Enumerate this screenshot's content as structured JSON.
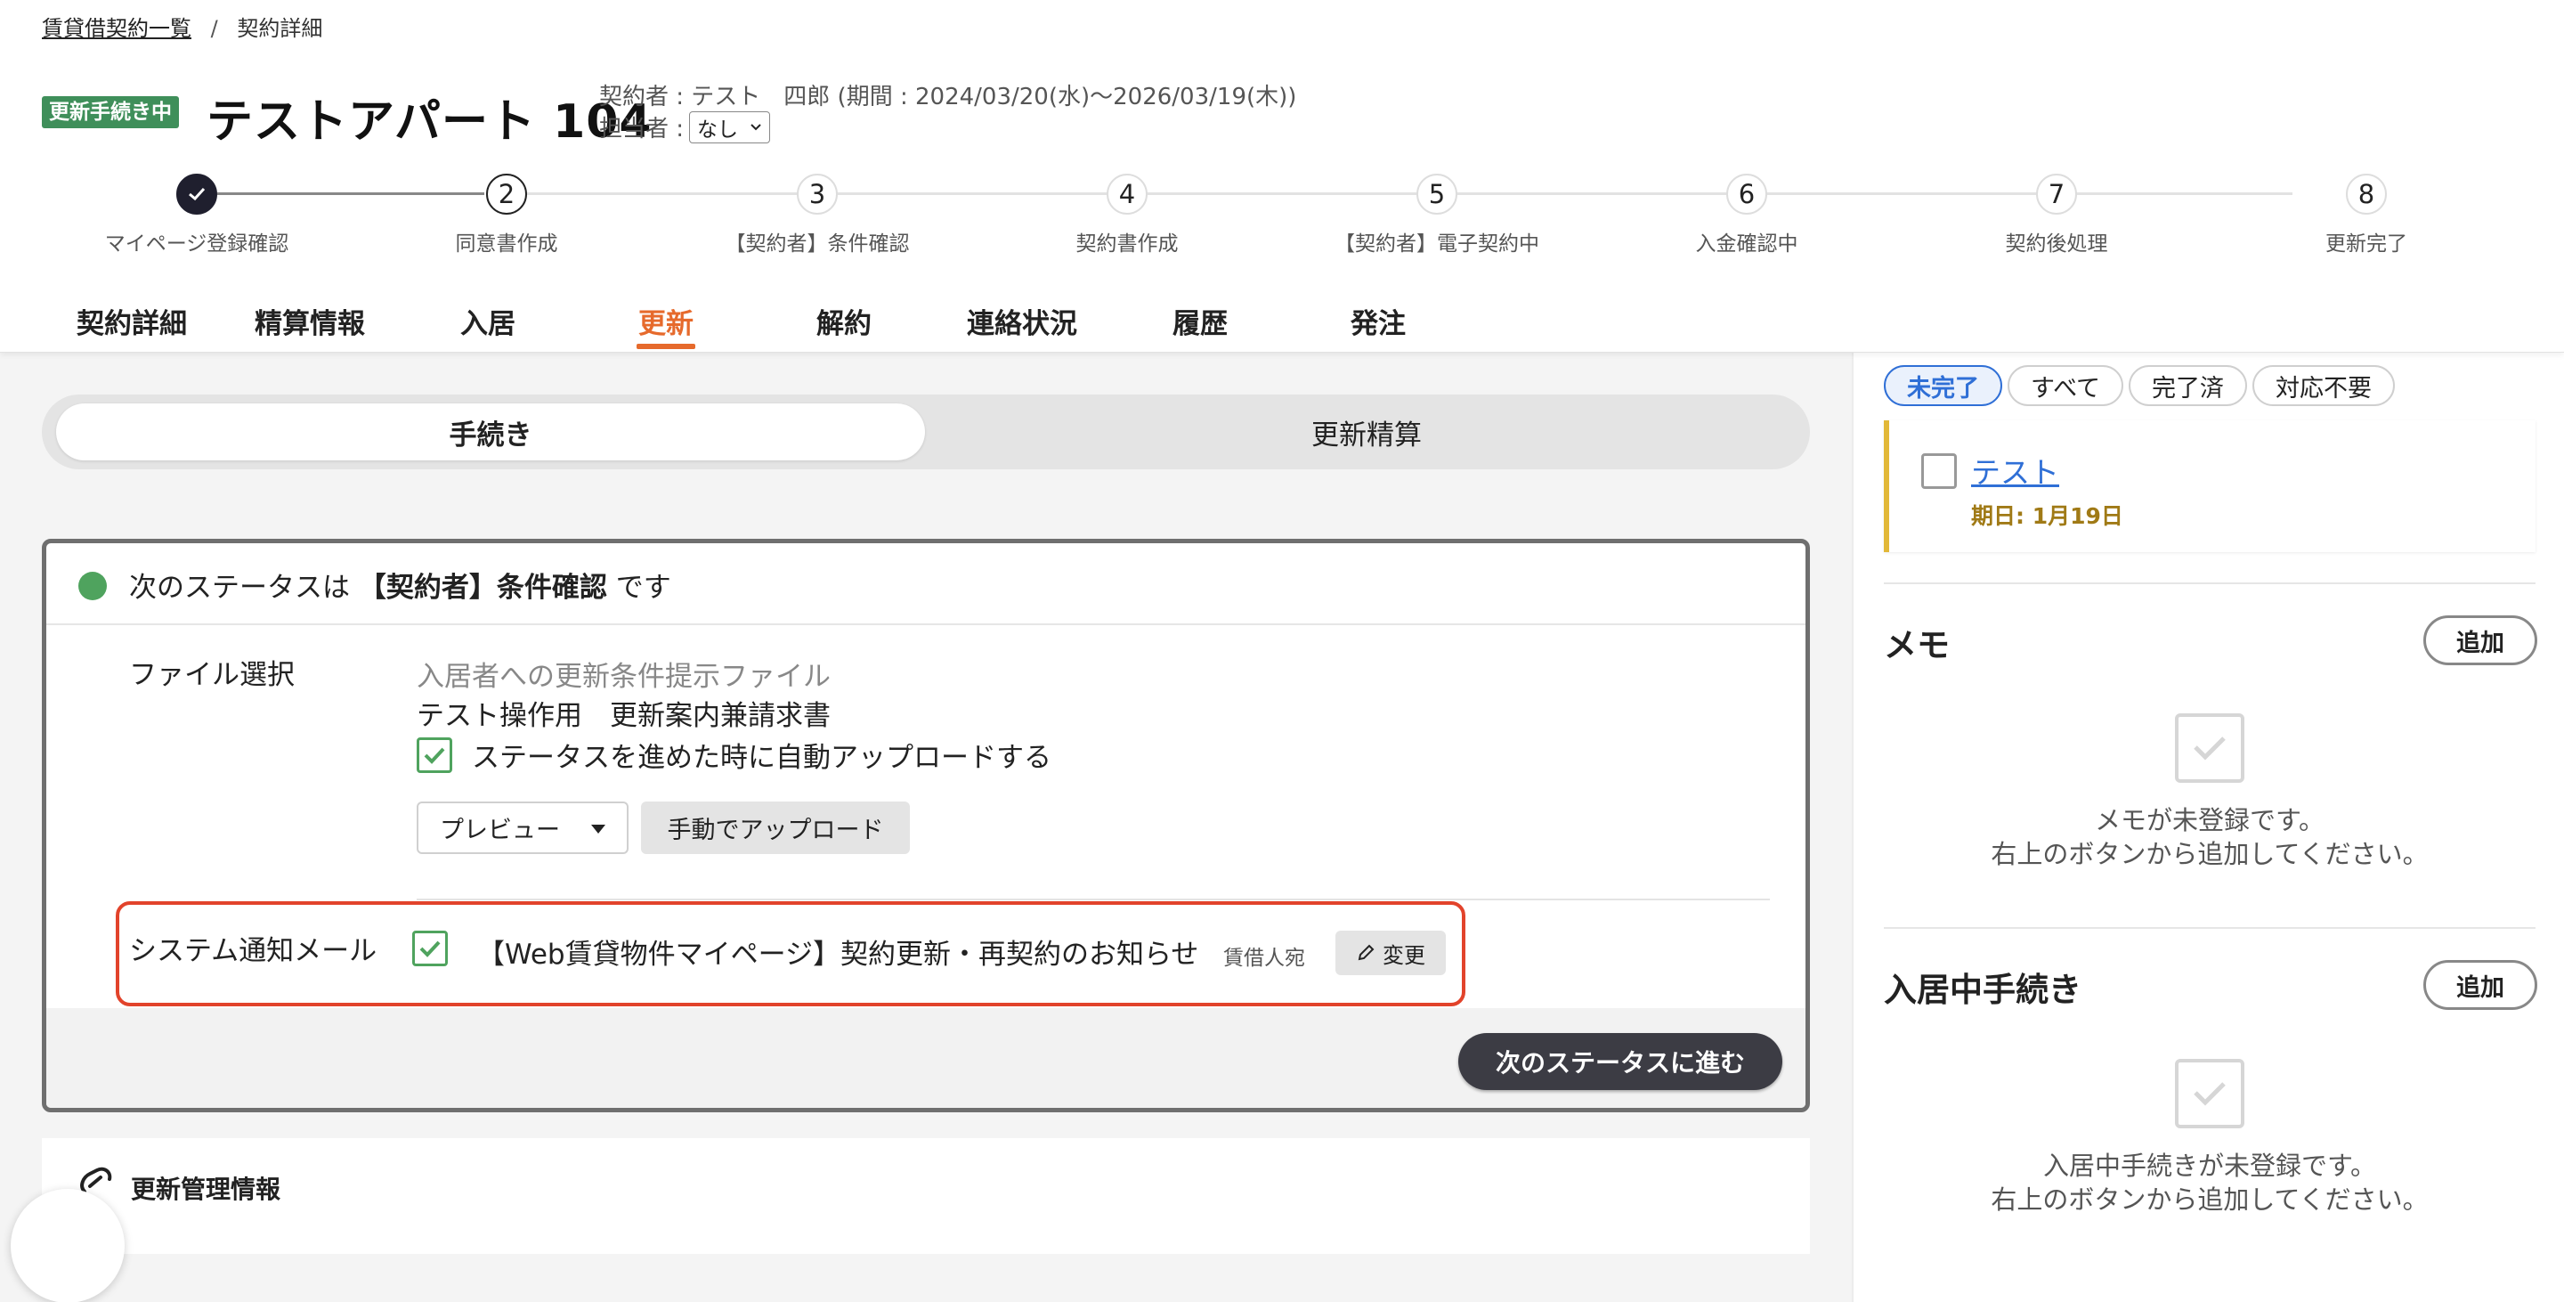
{
  "breadcrumb": {
    "list_link": "賃貸借契約一覧",
    "separator": "/",
    "current": "契約詳細"
  },
  "header": {
    "status_badge": "更新手続き中",
    "title": "テストアパート 104",
    "contract_meta": "契約者 : テスト　四郎 (期間 : 2024/03/20(水)〜2026/03/19(木))",
    "assignee_label": "担当者 :",
    "assignee_value": "なし"
  },
  "stepper": {
    "steps": [
      {
        "number": "",
        "label": "マイページ登録確認",
        "state": "done"
      },
      {
        "number": "2",
        "label": "同意書作成",
        "state": "current"
      },
      {
        "number": "3",
        "label": "【契約者】条件確認",
        "state": "pending"
      },
      {
        "number": "4",
        "label": "契約書作成",
        "state": "pending"
      },
      {
        "number": "5",
        "label": "【契約者】電子契約中",
        "state": "pending"
      },
      {
        "number": "6",
        "label": "入金確認中",
        "state": "pending"
      },
      {
        "number": "7",
        "label": "契約後処理",
        "state": "pending"
      },
      {
        "number": "8",
        "label": "更新完了",
        "state": "pending"
      }
    ]
  },
  "tabs": [
    {
      "label": "契約詳細",
      "active": false
    },
    {
      "label": "精算情報",
      "active": false
    },
    {
      "label": "入居",
      "active": false
    },
    {
      "label": "更新",
      "active": true
    },
    {
      "label": "解約",
      "active": false
    },
    {
      "label": "連絡状況",
      "active": false
    },
    {
      "label": "履歴",
      "active": false
    },
    {
      "label": "発注",
      "active": false
    }
  ],
  "segment": {
    "procedure": "手続き",
    "settlement": "更新精算"
  },
  "status_card": {
    "prefix": "次のステータスは",
    "status": "【契約者】条件確認",
    "suffix": "です",
    "file_select_label": "ファイル選択",
    "file_hint": "入居者への更新条件提示ファイル",
    "file_name": "テスト操作用　更新案内兼請求書",
    "auto_upload_label": "ステータスを進めた時に自動アップロードする",
    "preview_button": "プレビュー",
    "manual_upload_button": "手動でアップロード",
    "mail_label": "システム通知メール",
    "mail_subject": "【Web賃貸物件マイページ】契約更新・再契約のお知らせ",
    "mail_recipient": "賃借人宛",
    "change_button": "変更",
    "next_button": "次のステータスに進む"
  },
  "management": {
    "title": "更新管理情報"
  },
  "sidebar": {
    "filters": [
      {
        "label": "未完了",
        "active": true
      },
      {
        "label": "すべて",
        "active": false
      },
      {
        "label": "完了済",
        "active": false
      },
      {
        "label": "対応不要",
        "active": false
      }
    ],
    "task": {
      "title": "テスト",
      "due": "期日: 1月19日"
    },
    "memo": {
      "heading": "メモ",
      "add_button": "追加",
      "empty_line1": "メモが未登録です。",
      "empty_line2": "右上のボタンから追加してください。"
    },
    "residence": {
      "heading": "入居中手続き",
      "add_button": "追加",
      "empty_line1": "入居中手続きが未登録です。",
      "empty_line2": "右上のボタンから追加してください。"
    }
  },
  "colors": {
    "accent": "#e66a2c",
    "badge_green": "#3f8f5a",
    "status_dot": "#4fa35e",
    "highlight_red": "#e2432b",
    "link_blue": "#2f6fd6",
    "task_border": "#e2b838"
  }
}
